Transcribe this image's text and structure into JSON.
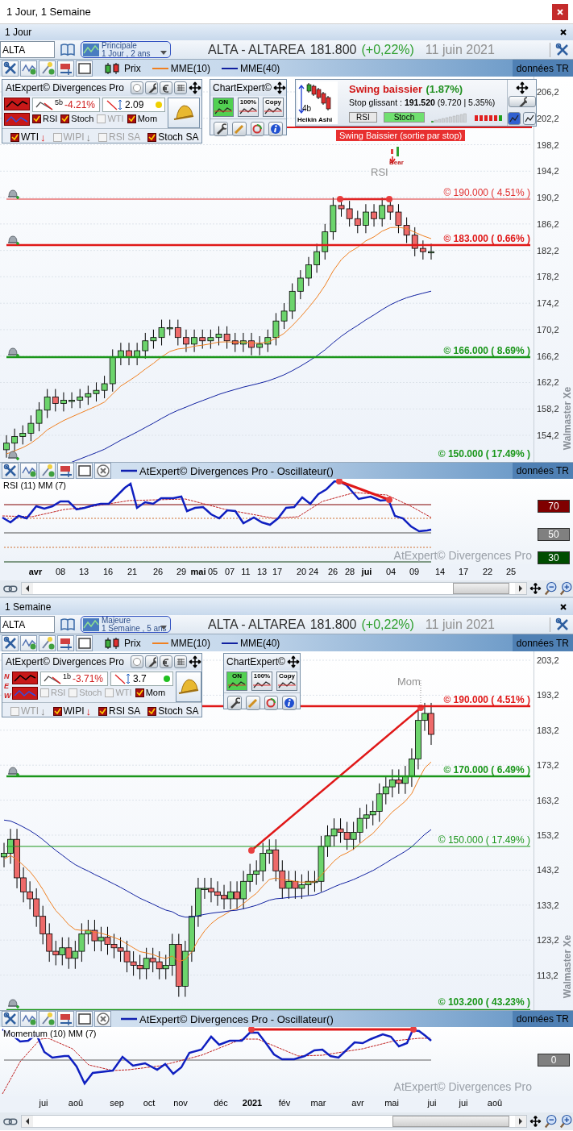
{
  "window": {
    "title": "1 Jour, 1 Semaine"
  },
  "panels": [
    {
      "title": "1 Jour",
      "symbol": "ALTA",
      "layout": {
        "name": "Principale",
        "period": "1 Jour , 2 ans"
      },
      "heading": "ALTA - ALTAREA",
      "price": "181.800",
      "change": "(+0,22%)",
      "date": "11 juin 2021",
      "legend": [
        {
          "kind": "candles",
          "label": "Prix"
        },
        {
          "kind": "short",
          "label": "MME(10)"
        },
        {
          "kind": "long",
          "label": "MME(40)"
        }
      ],
      "data_source": "données TR",
      "brand": "Walmaster Xe",
      "y_ticks": [
        "206,2",
        "202,2",
        "198,2",
        "194,2",
        "190,2",
        "186,2",
        "182,2",
        "178,2",
        "174,2",
        "170,2",
        "166,2",
        "162,2",
        "158,2",
        "154,2"
      ],
      "levels": [
        {
          "label": "© 190.000 ( 4.51% )",
          "color": "#e03030",
          "strong": false,
          "alarm": true
        },
        {
          "label": "© 183.000 ( 0.66% )",
          "color": "#e01818",
          "strong": true,
          "alarm": true
        },
        {
          "label": "© 166.000 ( 8.69% )",
          "color": "#1a961a",
          "strong": true,
          "alarm": true
        },
        {
          "label": "© 150.000 ( 17.49% )",
          "color": "#1a961a",
          "strong": true,
          "alarm": true
        }
      ],
      "stop": {
        "label": "Swing Baissier (sortie par stop)"
      },
      "annotations": [
        {
          "kind": "signal",
          "text": "RSI"
        },
        {
          "kind": "pattern",
          "text": "Bear"
        }
      ],
      "expert": {
        "title": "AtExpert© Divergences Pro",
        "bars": "5b",
        "change": "-4.21%",
        "ratio": "2.09",
        "signal": {
          "color": "#f0d000"
        },
        "filters": [
          {
            "label": "RSI",
            "checked": true
          },
          {
            "label": "Stoch",
            "checked": true
          },
          {
            "label": "WTI",
            "checked": false
          },
          {
            "label": "Mom",
            "checked": true
          }
        ],
        "alerts": [
          {
            "label": "WTI",
            "checked": true,
            "arrow": "↓"
          },
          {
            "label": "WIPI",
            "checked": false,
            "arrow": "↓"
          },
          {
            "label": "RSI SA",
            "checked": false
          },
          {
            "label": "Stoch SA",
            "checked": true
          }
        ]
      },
      "chart_expert": {
        "title": "ChartExpert©",
        "buttons": [
          {
            "label": "ON",
            "on": true
          },
          {
            "label": "100%",
            "on": false
          },
          {
            "label": "Copy",
            "on": false
          }
        ]
      },
      "swing": {
        "bars": "4b",
        "pattern": "Heikin Ashi",
        "title": "Swing baissier",
        "percent": "(1.87%)",
        "stop": "Stop glissant : **191.520**  (9.720 | 5.35%)",
        "tags": [
          {
            "label": "RSI",
            "on": false
          },
          {
            "label": "Stoch",
            "on": true
          }
        ]
      },
      "oscillator": {
        "legend": "AtExpert© Divergences Pro - Oscillateur()",
        "data_source": "données TR",
        "title": "RSI (11) MM (7)",
        "watermark": "AtExpert© Divergences Pro",
        "levels": [
          {
            "label": "70",
            "color": "#800000"
          },
          {
            "label": "50",
            "color": "#808080"
          },
          {
            "label": "30",
            "color": "#004d00"
          }
        ],
        "x_labels": [
          {
            "label": "avr",
            "major": true
          },
          {
            "label": "08",
            "major": false
          },
          {
            "label": "13",
            "major": false
          },
          {
            "label": "16",
            "major": false
          },
          {
            "label": "21",
            "major": false
          },
          {
            "label": "26",
            "major": false
          },
          {
            "label": "29",
            "major": false
          },
          {
            "label": "mai",
            "major": true
          },
          {
            "label": "05",
            "major": false
          },
          {
            "label": "07",
            "major": false
          },
          {
            "label": "11",
            "major": false
          },
          {
            "label": "13",
            "major": false
          },
          {
            "label": "17",
            "major": false
          },
          {
            "label": "20",
            "major": false
          },
          {
            "label": "24",
            "major": false
          },
          {
            "label": "26",
            "major": false
          },
          {
            "label": "28",
            "major": false
          },
          {
            "label": "jui",
            "major": true
          },
          {
            "label": "04",
            "major": false
          },
          {
            "label": "09",
            "major": false
          },
          {
            "label": "14",
            "major": false
          },
          {
            "label": "17",
            "major": false
          },
          {
            "label": "22",
            "major": false
          },
          {
            "label": "25",
            "major": false
          }
        ]
      }
    },
    {
      "title": "1 Semaine",
      "symbol": "ALTA",
      "layout": {
        "name": "Majeure",
        "period": "1 Semaine , 5 ans"
      },
      "heading": "ALTA - ALTAREA",
      "price": "181.800",
      "change": "(+0,22%)",
      "date": "11 juin 2021",
      "legend": [
        {
          "kind": "candles",
          "label": "Prix"
        },
        {
          "kind": "short",
          "label": "MME(10)"
        },
        {
          "kind": "long",
          "label": "MME(40)"
        }
      ],
      "data_source": "données TR",
      "brand": "Walmaster Xe",
      "y_ticks": [
        "203,2",
        "193,2",
        "183,2",
        "173,2",
        "163,2",
        "153,2",
        "143,2",
        "133,2",
        "123,2",
        "113,2"
      ],
      "levels": [
        {
          "label": "© 190.000 ( 4.51% )",
          "color": "#e01818",
          "strong": true,
          "alarm": false
        },
        {
          "label": "© 170.000 ( 6.49% )",
          "color": "#1a961a",
          "strong": true,
          "alarm": true
        },
        {
          "label": "© 150.000 ( 17.49% )",
          "color": "#1a961a",
          "strong": false,
          "alarm": false
        },
        {
          "label": "© 103.200 ( 43.23% )",
          "color": "#1a961a",
          "strong": true,
          "alarm": true
        }
      ],
      "annotations": [
        {
          "kind": "signal",
          "text": "Mom"
        }
      ],
      "expert": {
        "title": "AtExpert© Divergences Pro",
        "letters": [
          "N",
          "E",
          "W"
        ],
        "bars": "1b",
        "change": "-3.71%",
        "ratio": "3.7",
        "signal": {
          "color": "#20c020"
        },
        "filters": [
          {
            "label": "RSI",
            "checked": false
          },
          {
            "label": "Stoch",
            "checked": false
          },
          {
            "label": "WTI",
            "checked": false
          },
          {
            "label": "Mom",
            "checked": true
          }
        ],
        "alerts": [
          {
            "label": "WTI",
            "checked": false,
            "arrow": "↓"
          },
          {
            "label": "WIPI",
            "checked": true,
            "arrow": "↓"
          },
          {
            "label": "RSI SA",
            "checked": true
          },
          {
            "label": "Stoch SA",
            "checked": true
          }
        ]
      },
      "chart_expert": {
        "title": "ChartExpert©",
        "buttons": [
          {
            "label": "ON",
            "on": true
          },
          {
            "label": "100%",
            "on": false
          },
          {
            "label": "Copy",
            "on": false
          }
        ]
      },
      "oscillator": {
        "legend": "AtExpert© Divergences Pro - Oscillateur()",
        "data_source": "données TR",
        "title": "Momentum (10) MM (7)",
        "watermark": "AtExpert© Divergences Pro",
        "levels": [
          {
            "label": "0",
            "color": "#808080"
          }
        ],
        "x_labels": [
          {
            "label": "jui",
            "major": false
          },
          {
            "label": "aoû",
            "major": false
          },
          {
            "label": "sep",
            "major": false
          },
          {
            "label": "oct",
            "major": false
          },
          {
            "label": "nov",
            "major": false
          },
          {
            "label": "déc",
            "major": false
          },
          {
            "label": "2021",
            "major": true
          },
          {
            "label": "fév",
            "major": false
          },
          {
            "label": "mar",
            "major": false
          },
          {
            "label": "avr",
            "major": false
          },
          {
            "label": "mai",
            "major": false
          },
          {
            "label": "jui",
            "major": false
          },
          {
            "label": "jui",
            "major": false
          },
          {
            "label": "aoû",
            "major": false
          }
        ]
      }
    }
  ]
}
